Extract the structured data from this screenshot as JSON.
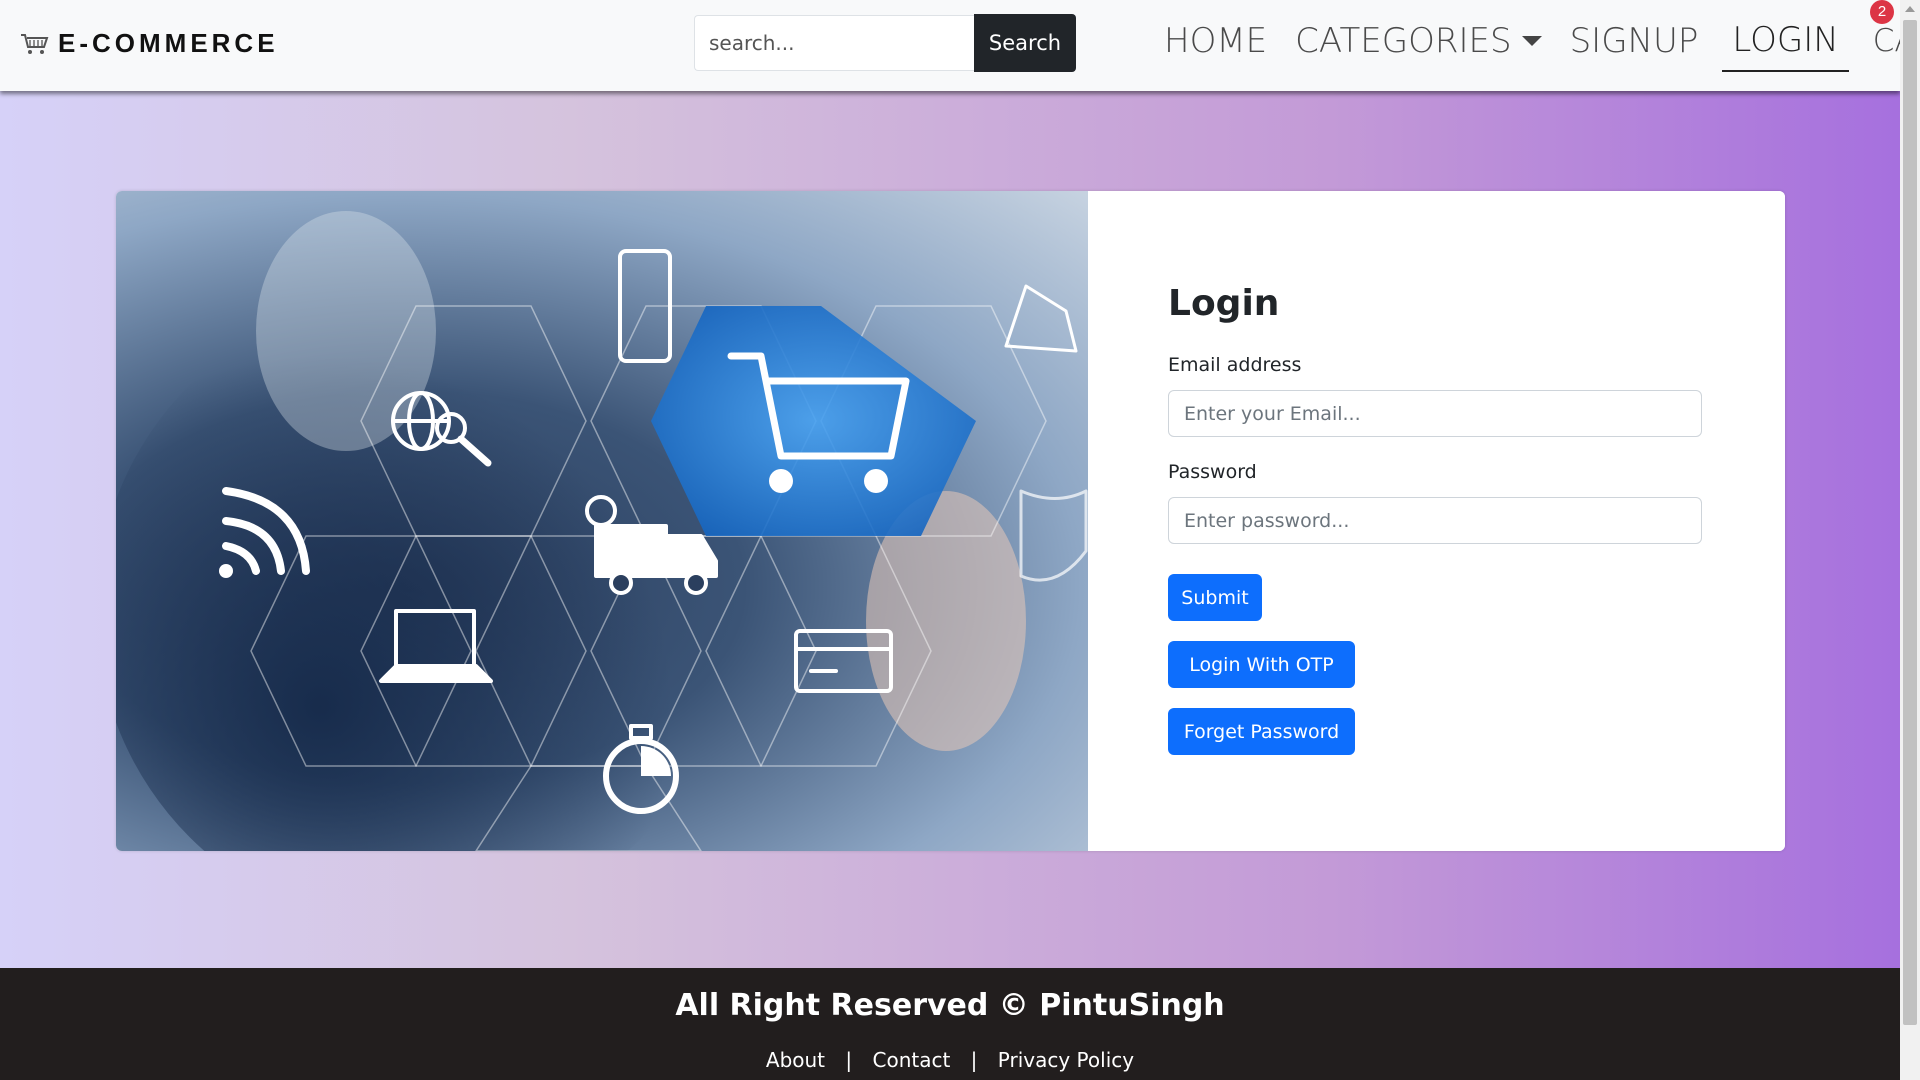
{
  "brand": {
    "name": "E-COMMERCE",
    "icon": "shopping-cart-icon"
  },
  "search": {
    "placeholder": "search...",
    "value": "",
    "button_label": "Search"
  },
  "nav": {
    "items": [
      {
        "label": "HOME"
      },
      {
        "label": "CATEGORIES",
        "icon": "caret-down-icon"
      },
      {
        "label": "SIGNUP"
      },
      {
        "label": "LOGIN",
        "active": true
      },
      {
        "label": "CART"
      }
    ],
    "cart_count": "2"
  },
  "hero_icons": [
    "smartphone-icon",
    "map-pin-icon",
    "globe-search-icon",
    "shopping-cart-icon",
    "wifi-icon",
    "delivery-truck-icon",
    "shield-check-icon",
    "laptop-icon",
    "credit-card-icon",
    "stopwatch-icon"
  ],
  "login": {
    "title": "Login",
    "email_label": "Email address",
    "email_placeholder": "Enter your Email...",
    "password_label": "Password",
    "password_placeholder": "Enter password...",
    "submit_label": "Submit",
    "otp_label": "Login With OTP",
    "forgot_label": "Forget Password"
  },
  "footer": {
    "title": "All Right Reserved © PintuSingh",
    "links": [
      {
        "label": "About"
      },
      {
        "label": "Contact"
      },
      {
        "label": "Privacy Policy"
      }
    ],
    "separator": "|"
  },
  "colors": {
    "primary": "#0d6efd",
    "navbar_bg": "#f8f9fa",
    "footer_bg": "#221e1e",
    "badge": "#dc3545",
    "gradient_start": "#d6d1f8",
    "gradient_end": "#a670de"
  }
}
